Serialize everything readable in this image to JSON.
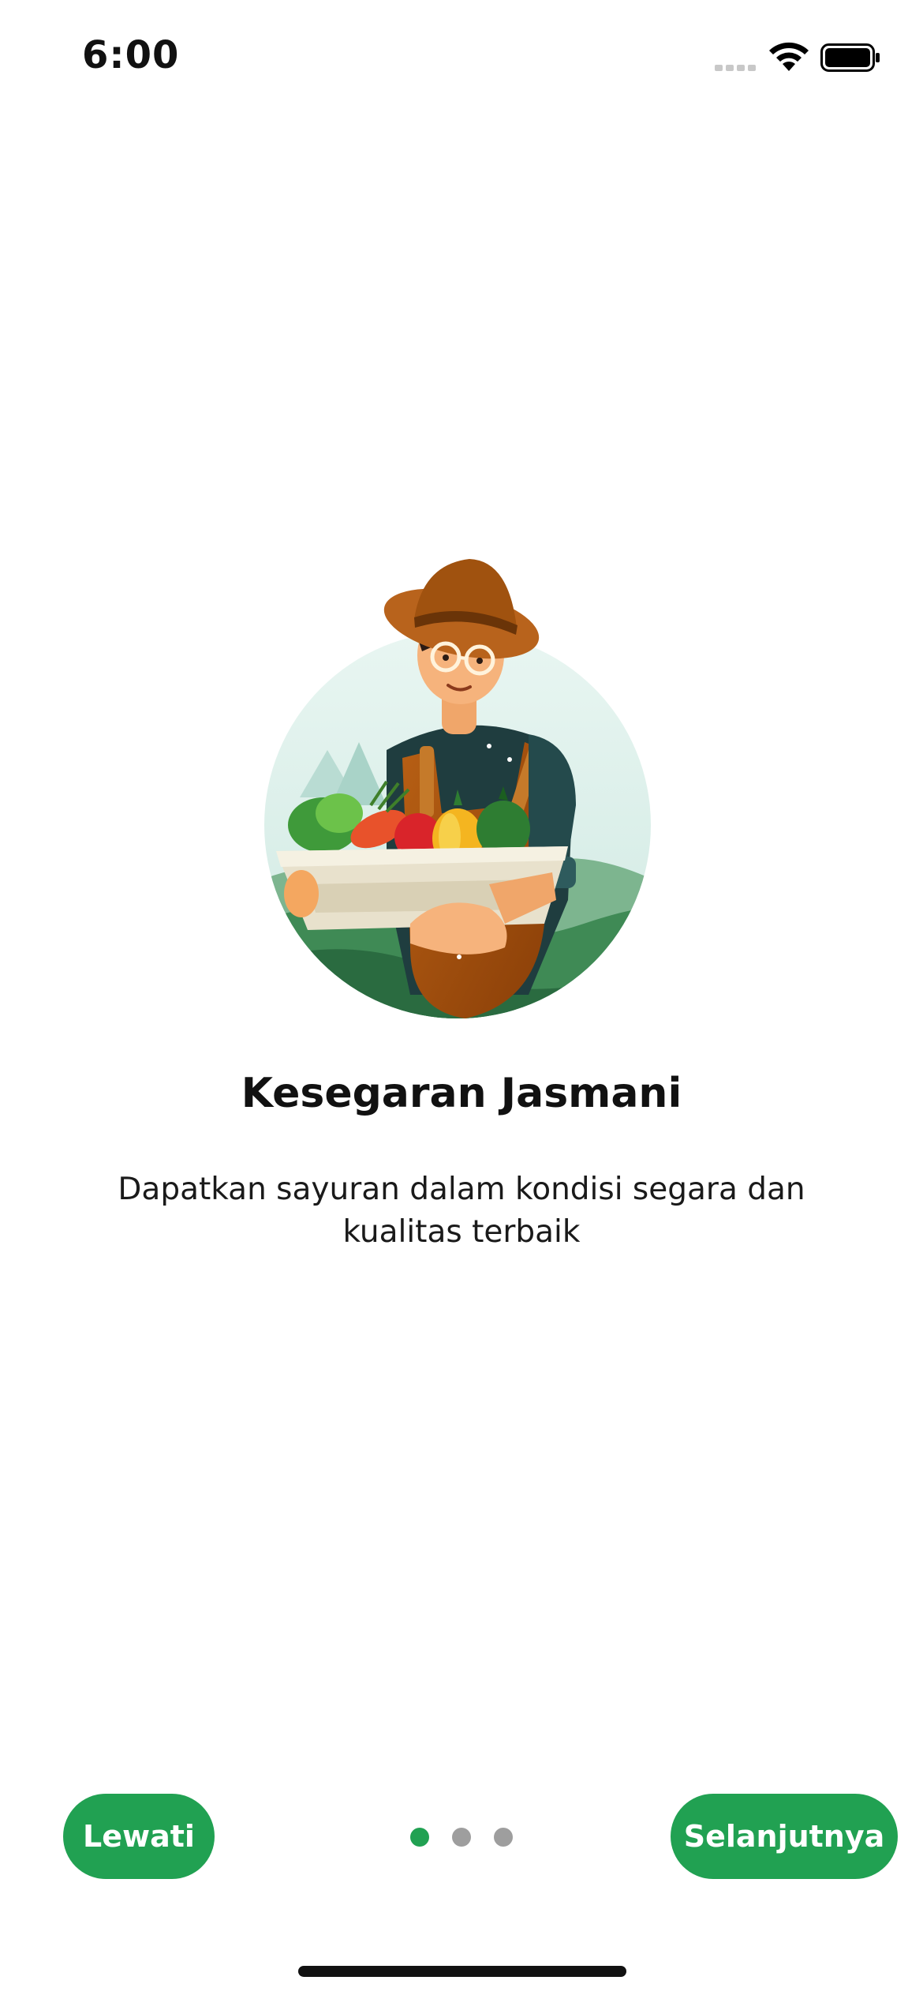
{
  "status_bar": {
    "time": "6:00",
    "icons": [
      "cellular-signal-icon",
      "wifi-icon",
      "battery-icon"
    ]
  },
  "onboarding": {
    "illustration": "farmer-with-vegetable-basket",
    "title": "Kesegaran Jasmani",
    "description": "Dapatkan sayuran dalam kondisi segara dan kualitas terbaik",
    "page_count": 3,
    "current_page": 1
  },
  "buttons": {
    "skip_label": "Lewati",
    "next_label": "Selanjutnya"
  },
  "colors": {
    "accent": "#21a152",
    "inactive_dot": "#9e9e9e",
    "text": "#111111",
    "background": "#ffffff"
  }
}
